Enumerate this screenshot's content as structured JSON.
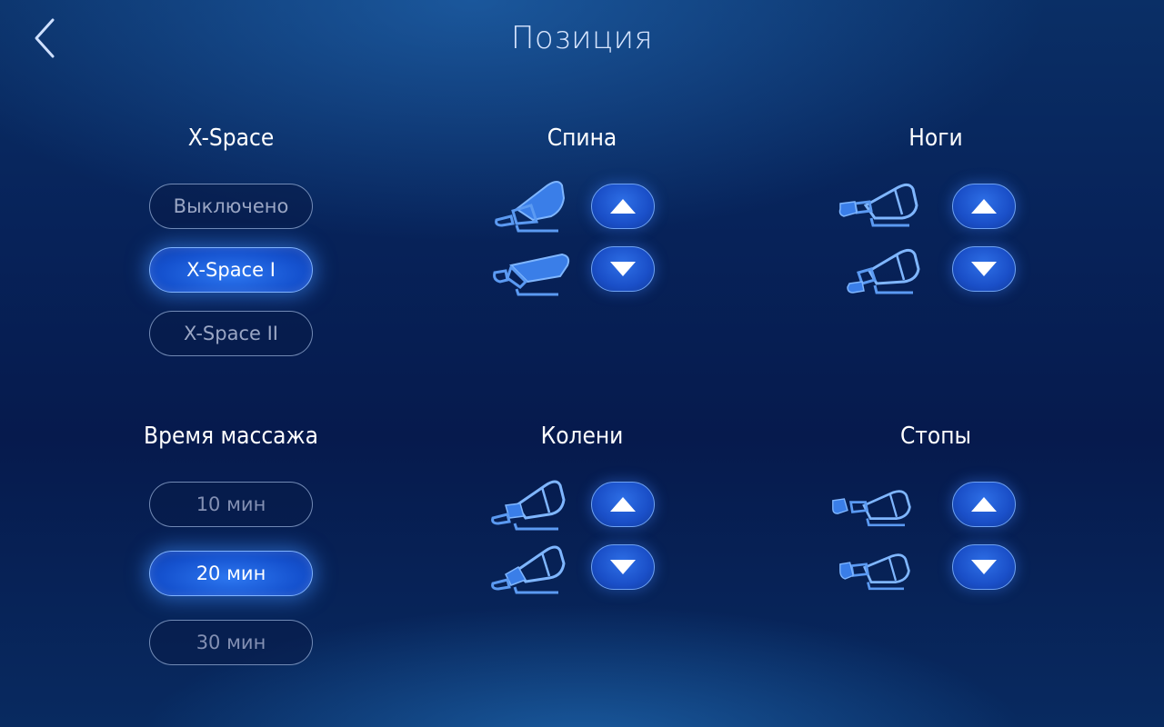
{
  "header": {
    "title": "Позиция"
  },
  "xspace": {
    "title": "X-Space",
    "options": [
      "Выключено",
      "X-Space I",
      "X-Space II"
    ],
    "selected": "X-Space I"
  },
  "massage_time": {
    "title": "Время массажа",
    "options": [
      "10 мин",
      "20 мин",
      "30 мин"
    ],
    "selected": "20 мин"
  },
  "back": {
    "title": "Спина"
  },
  "legs": {
    "title": "Ноги"
  },
  "knees": {
    "title": "Колени"
  },
  "feet": {
    "title": "Стопы"
  },
  "colors": {
    "accent": "#1f5fe0",
    "accent_glow": "#3d8cff",
    "icon_blue": "#4a8ff0",
    "background": "#07235a"
  },
  "icons": {
    "back_button": "chevron-left-icon",
    "arrow_up": "arrow-up-icon",
    "arrow_down": "arrow-down-icon",
    "chair": "massage-chair-icon"
  }
}
